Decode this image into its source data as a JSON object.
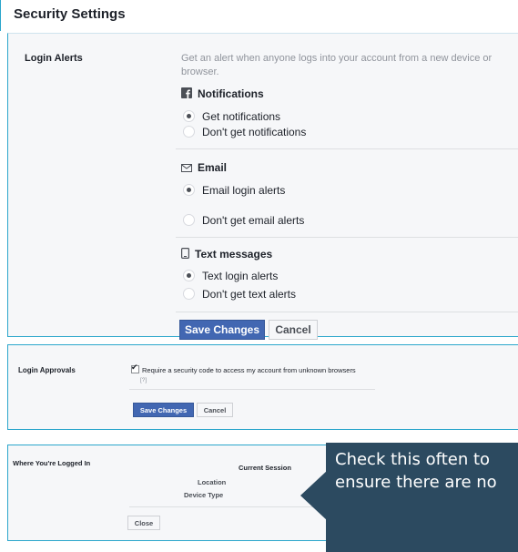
{
  "page": {
    "title": "Security Settings"
  },
  "login_alerts": {
    "label": "Login Alerts",
    "description": "Get an alert when anyone logs into your account from a new device or browser.",
    "notifications": {
      "heading": "Notifications",
      "icon": "facebook-icon",
      "options": [
        "Get notifications",
        "Don't get notifications"
      ],
      "selected": 0
    },
    "email": {
      "heading": "Email",
      "icon": "envelope-icon",
      "options": [
        "Email login alerts",
        "Don't get email alerts"
      ],
      "selected": 0
    },
    "text_messages": {
      "heading": "Text messages",
      "icon": "phone-icon",
      "options": [
        "Text login alerts",
        "Don't get text alerts"
      ],
      "selected": 0
    },
    "save_label": "Save Changes",
    "cancel_label": "Cancel"
  },
  "login_approvals": {
    "label": "Login Approvals",
    "checkbox_label": "Require a security code to access my account from unknown browsers",
    "checked": true,
    "help": "[?]",
    "save_label": "Save Changes",
    "cancel_label": "Cancel"
  },
  "logged_in": {
    "label": "Where You're Logged In",
    "current_session": "Current Session",
    "location_label": "Location",
    "device_type_label": "Device Type",
    "close_label": "Close"
  },
  "callout": {
    "text": "Check this often to ensure there are no"
  },
  "colors": {
    "primary_button": "#4267b2",
    "callout_bg": "#2c4a60",
    "panel_border": "#2ba6cb"
  }
}
